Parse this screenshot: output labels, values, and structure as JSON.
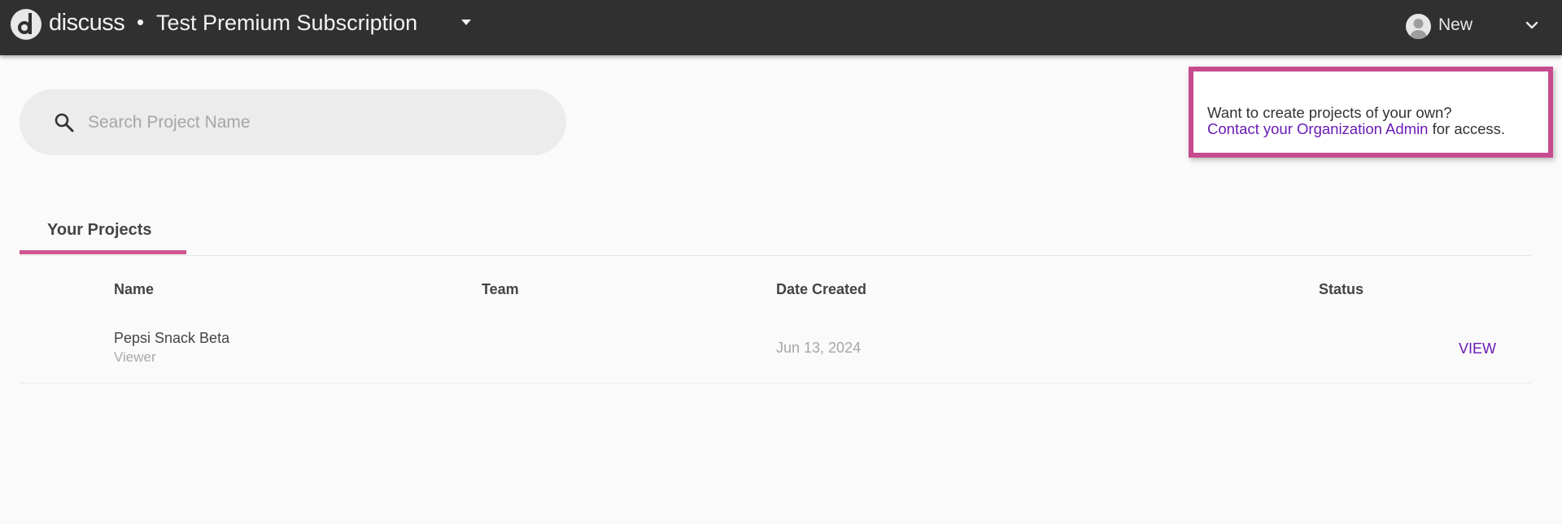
{
  "header": {
    "brand": "discuss",
    "separator": "•",
    "organization": "Test Premium Subscription",
    "user_name": "New",
    "icons": [
      "discuss-logo-icon",
      "caret-down-icon",
      "user-avatar-icon",
      "chevron-down-icon"
    ]
  },
  "search": {
    "placeholder": "Search Project Name",
    "value": "",
    "icon": "search-icon"
  },
  "info_box": {
    "text": "Want to create projects of your own?",
    "link_label": "Contact your Organization Admin",
    "suffix": " for access."
  },
  "tabs": [
    {
      "label": "Your Projects",
      "active": true
    }
  ],
  "table": {
    "columns": [
      "Name",
      "Team",
      "Date Created",
      "Status"
    ],
    "rows": [
      {
        "name": "Pepsi Snack Beta",
        "role": "Viewer",
        "team": "",
        "date_created": "Jun 13, 2024",
        "action": "VIEW"
      }
    ]
  },
  "colors": {
    "topbar": "#303030",
    "accent_pink": "#c64b8f",
    "tab_underline": "#d05590",
    "link_purple": "#6a1bb5",
    "page_bg": "#fafafa"
  }
}
